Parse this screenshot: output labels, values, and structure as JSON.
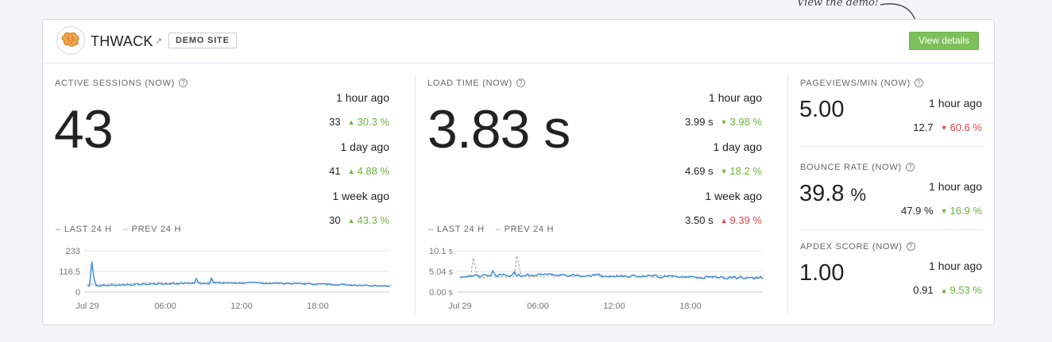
{
  "annotation": "View the demo!",
  "header": {
    "site_name": "THWACK",
    "badge": "DEMO SITE",
    "button": "View details"
  },
  "active_sessions": {
    "label": "ACTIVE SESSIONS (NOW)",
    "value": "43",
    "comparisons": [
      {
        "period": "1 hour ago",
        "value": "33",
        "change": "30.3 %",
        "direction": "up"
      },
      {
        "period": "1 day ago",
        "value": "41",
        "change": "4.88 %",
        "direction": "up"
      },
      {
        "period": "1 week ago",
        "value": "30",
        "change": "43.3 %",
        "direction": "up"
      }
    ],
    "legend": {
      "current": "LAST 24 H",
      "previous": "PREV 24 H"
    },
    "chart": {
      "y_ticks": [
        "233",
        "116.5",
        "0"
      ],
      "x_ticks": [
        "Jul 29",
        "06:00",
        "12:00",
        "18:00"
      ],
      "ylim": [
        0,
        233
      ]
    }
  },
  "load_time": {
    "label": "LOAD TIME (NOW)",
    "value": "3.83",
    "unit": "s",
    "comparisons": [
      {
        "period": "1 hour ago",
        "value": "3.99 s",
        "change": "3.98 %",
        "direction": "down"
      },
      {
        "period": "1 day ago",
        "value": "4.69 s",
        "change": "18.2 %",
        "direction": "down"
      },
      {
        "period": "1 week ago",
        "value": "3.50 s",
        "change": "9.39 %",
        "direction": "up"
      }
    ],
    "legend": {
      "current": "LAST 24 H",
      "previous": "PREV 24 H"
    },
    "chart": {
      "y_ticks": [
        "10.1 s",
        "5.04 s",
        "0.00 s"
      ],
      "x_ticks": [
        "Jul 29",
        "06:00",
        "12:00",
        "18:00"
      ],
      "ylim": [
        0,
        10.1
      ]
    }
  },
  "pageviews": {
    "label": "PAGEVIEWS/MIN (NOW)",
    "value": "5.00",
    "period": "1 hour ago",
    "prev": "12.7",
    "change": "60.6 %",
    "direction": "down"
  },
  "bounce_rate": {
    "label": "BOUNCE RATE (NOW)",
    "value": "39.8",
    "unit": "%",
    "period": "1 hour ago",
    "prev": "47.9 %",
    "change": "16.9 %",
    "direction": "up"
  },
  "apdex": {
    "label": "APDEX SCORE (NOW)",
    "value": "1.00",
    "period": "1 hour ago",
    "prev": "0.91",
    "change": "9.53 %",
    "direction": "up"
  },
  "colors": {
    "accent": "#7dc05a",
    "current_series": "#3b8fd9",
    "previous_series": "#aaaaaa",
    "up": "#6cb23c",
    "down": "#e0454a"
  }
}
